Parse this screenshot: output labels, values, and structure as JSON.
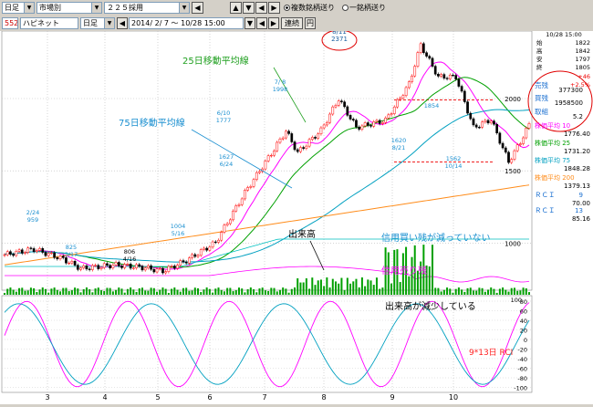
{
  "toolbar1": {
    "period_select": "日足",
    "market_select": "市場別",
    "index_select": "２２５採用",
    "date_range": "2014/ 2/ 7 〜 10/28 15:00",
    "radio_multi": "複数銘柄送り",
    "radio_single": "一銘柄送り"
  },
  "toolbar2": {
    "code_input": "552",
    "name_label": "ハピネット",
    "period_select": "日足",
    "btn_prev": "◀",
    "btn_next": "▶",
    "renkei_button": "連続",
    "yen_button": "円"
  },
  "chart": {
    "month_labels": [
      "3",
      "4",
      "5",
      "6",
      "7",
      "8",
      "9",
      "10"
    ],
    "price_ticks": [
      "2000",
      "1500",
      "1000"
    ],
    "volume_ticks": [
      "100"
    ],
    "rci_ticks": [
      "80",
      "60",
      "40",
      "20",
      "0",
      "-20",
      "-40",
      "-60",
      "-80",
      "-100"
    ],
    "annotations": {
      "high": "8/11\n2371",
      "ma25": "25日移動平均線",
      "ma75": "75日移動平均線",
      "a_0710": "7/ 8\n1998",
      "a_0610": "6/10\n1777",
      "a_0624": "1627\n6/24",
      "a_0224": "2/24\n959",
      "a_0317": "825\n3/17",
      "a_0416": "806\n4/16",
      "a_0516": "1004\n5/16",
      "a_0820": "1620\n8/21",
      "a_0903": "1854",
      "a_1014": "1562\n10/14",
      "volume_label": "出来高",
      "margin_buy": "信用買い残が減っていない",
      "margin_sell": "信用売り残",
      "volume_decline": "出来高が減少している",
      "rci_label": "9*13日 RCI"
    }
  },
  "side_panel": {
    "date": "10/28 15:00",
    "ohlc": [
      "1822",
      "1842",
      "1797",
      "1805"
    ],
    "change": "+46",
    "change2": "+2.5%",
    "sell_label": "売残",
    "sell_value": "377300",
    "buy_label": "買残",
    "buy_value": "1958500",
    "ratio_label": "取組",
    "ratio_value": "5.2",
    "ma_labels": [
      {
        "label": "株価平均",
        "sub": "10",
        "value": "1776.40"
      },
      {
        "label": "株価平均",
        "sub": "25",
        "value": "1731.20"
      },
      {
        "label": "株価平均",
        "sub": "75",
        "value": "1848.28"
      },
      {
        "label": "株価平均",
        "sub": "200",
        "value": "1379.13"
      }
    ],
    "rci_rows": [
      {
        "label": "ＲＣＩ",
        "sub": "9",
        "value": "70.00"
      },
      {
        "label": "ＲＣＩ",
        "sub": "13",
        "value": "85.16"
      }
    ]
  },
  "colors": {
    "ma10": "#ff00ff",
    "ma25": "#00a000",
    "ma75": "#00a0c0",
    "ma200": "#ff8c1a",
    "candle_up": "#ff0000",
    "candle_down": "#000000",
    "volume": "#00a000",
    "buy_margin": "#00c0c0",
    "sell_margin": "#ff00ff",
    "annotation": "#1a8fd0",
    "circle": "#e00000"
  }
}
